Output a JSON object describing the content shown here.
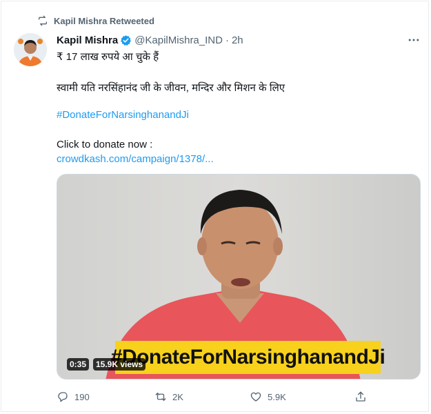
{
  "retweet_header": {
    "label": "Kapil Mishra Retweeted"
  },
  "author": {
    "name": "Kapil Mishra",
    "handle": "@KapilMishra_IND",
    "separator": "·",
    "time": "2h"
  },
  "tweet": {
    "line1": "₹ 17 लाख रुपये आ चुके हैं",
    "line2": "स्वामी यति नरसिंहानंद जी के जीवन, मन्दिर और मिशन के लिए",
    "hashtag": "#DonateForNarsinghanandJi",
    "line3": "Click to donate now :",
    "link": "crowdkash.com/campaign/1378/..."
  },
  "media": {
    "banner_text": "#DonateForNarsinghanandJi",
    "duration": "0:35",
    "views": "15.9K views"
  },
  "actions": {
    "replies": "190",
    "retweets": "2K",
    "likes": "5.9K"
  },
  "icons": {
    "retweet_header": "retweet-icon",
    "verified": "verified-badge-icon",
    "more": "more-icon",
    "reply": "reply-icon",
    "retweet": "retweet-icon",
    "like": "heart-icon",
    "share": "share-icon"
  },
  "colors": {
    "link": "#1d9bf0",
    "secondary_text": "#536471",
    "banner": "#f7d11c",
    "shirt": "#e8555a"
  }
}
